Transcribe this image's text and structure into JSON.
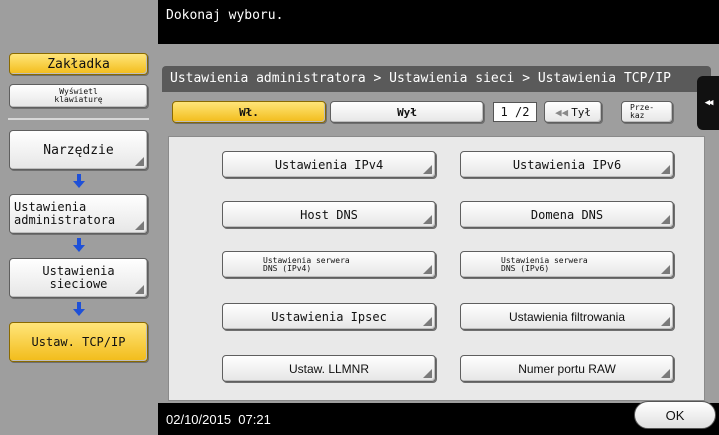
{
  "header": {
    "instruction": "Dokonaj wyboru."
  },
  "left": {
    "bookmark_label": "Zakładka",
    "keyboard_label_line1": "Wyświetl",
    "keyboard_label_line2": "klawiaturę",
    "path": [
      {
        "label": "Narzędzie"
      },
      {
        "label_line1": "Ustawienia",
        "label_line2": "administratora"
      },
      {
        "label_line1": "Ustawienia",
        "label_line2": "sieciowe"
      },
      {
        "label": "Ustaw. TCP/IP"
      }
    ]
  },
  "main": {
    "breadcrumb": "Ustawienia administratora > Ustawienia sieci > Ustawienia TCP/IP",
    "toggle": {
      "on_label": "Wł.",
      "off_label": "Wył"
    },
    "pager": {
      "page": "1 /2",
      "back_label": "Tył",
      "next_line1": "Prze-",
      "next_line2": "kaz"
    },
    "buttons": [
      {
        "label": "Ustawienia IPv4"
      },
      {
        "label": "Ustawienia IPv6"
      },
      {
        "label": "Host DNS"
      },
      {
        "label": "Domena DNS"
      },
      {
        "label_line1": "Ustawienia serwera",
        "label_line2": "DNS (IPv4)"
      },
      {
        "label_line1": "Ustawienia serwera",
        "label_line2": "DNS (IPv6)"
      },
      {
        "label": "Ustawienia Ipsec"
      },
      {
        "label": "Ustawienia filtrowania"
      },
      {
        "label": "Ustaw. LLMNR"
      },
      {
        "label": "Numer portu RAW"
      }
    ]
  },
  "footer": {
    "datetime": "02/10/2015  07:21",
    "ok_label": "OK"
  },
  "colors": {
    "accent_yellow": "#f2bc1a",
    "arrow_blue": "#1e50d8",
    "panel_gray": "#9e9e9e"
  }
}
